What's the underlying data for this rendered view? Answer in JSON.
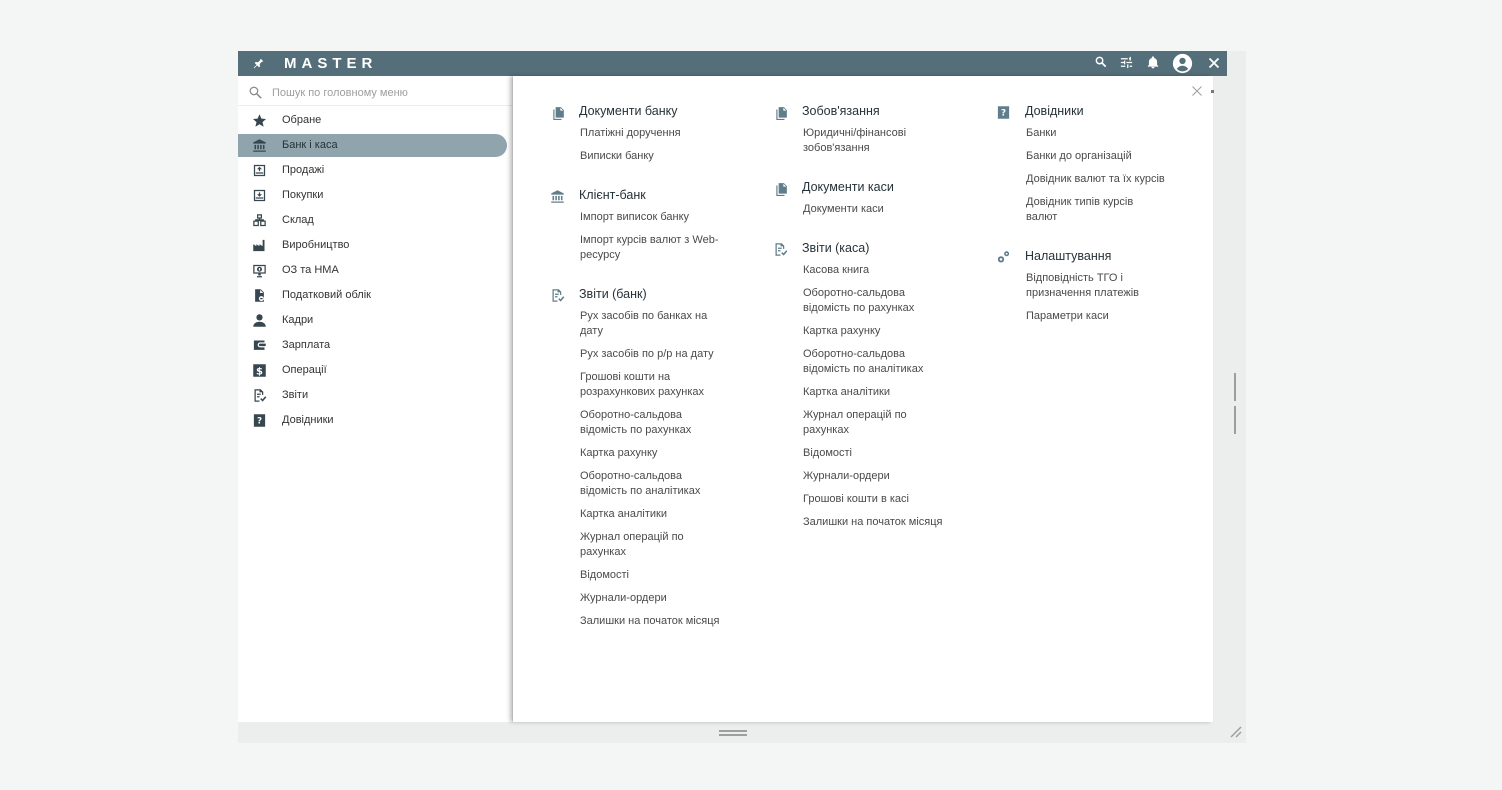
{
  "app": {
    "brand": "MASTER"
  },
  "colors": {
    "topbar": "#546e7a",
    "active_item": "#90a4ae",
    "icon": "#37474f",
    "group_icon": "#607d8b"
  },
  "toolbar": {
    "icons": [
      "pin-icon",
      "search-icon",
      "tune-icon",
      "bell-icon",
      "account-circle-icon",
      "close-icon"
    ]
  },
  "search": {
    "placeholder": "Пошук по головному меню",
    "value": ""
  },
  "sidebar": {
    "active": "Банк і каса",
    "items": [
      {
        "label": "Обране",
        "icon": "star-icon"
      },
      {
        "label": "Банк і каса",
        "icon": "bank-icon"
      },
      {
        "label": "Продажі",
        "icon": "sales-icon"
      },
      {
        "label": "Покупки",
        "icon": "purchases-icon"
      },
      {
        "label": "Склад",
        "icon": "warehouse-icon"
      },
      {
        "label": "Виробництво",
        "icon": "factory-icon"
      },
      {
        "label": "ОЗ та НМА",
        "icon": "assets-icon"
      },
      {
        "label": "Податковий облік",
        "icon": "tax-icon"
      },
      {
        "label": "Кадри",
        "icon": "person-icon"
      },
      {
        "label": "Зарплата",
        "icon": "wallet-icon"
      },
      {
        "label": "Операції",
        "icon": "dollar-icon"
      },
      {
        "label": "Звіти",
        "icon": "report-icon"
      },
      {
        "label": "Довідники",
        "icon": "help-book-icon"
      }
    ]
  },
  "columns": [
    {
      "groups": [
        {
          "title": "Документи банку",
          "icon": "documents-icon",
          "links": [
            "Платіжні доручення",
            "Виписки банку"
          ]
        },
        {
          "title": "Клієнт-банк",
          "icon": "bank-icon",
          "links": [
            "Імпорт виписок банку",
            "Імпорт курсів валют з Web-ресурсу"
          ]
        },
        {
          "title": "Звіти (банк)",
          "icon": "report-icon",
          "links": [
            "Рух засобів по банках на дату",
            "Рух засобів по р/р на дату",
            "Грошові кошти на розрахункових рахунках",
            "Оборотно-сальдова відомість по рахунках",
            "Картка рахунку",
            "Оборотно-сальдова відомість по аналітиках",
            "Картка аналітики",
            "Журнал операцій по рахунках",
            "Відомості",
            "Журнали-ордери",
            "Залишки на початок місяця"
          ]
        }
      ]
    },
    {
      "groups": [
        {
          "title": "Зобов'язання",
          "icon": "documents-icon",
          "links": [
            "Юридичні/фінансові зобов'язання"
          ]
        },
        {
          "title": "Документи каси",
          "icon": "documents-icon",
          "links": [
            "Документи каси"
          ]
        },
        {
          "title": "Звіти (каса)",
          "icon": "report-icon",
          "links": [
            "Касова книга",
            "Оборотно-сальдова відомість по рахунках",
            "Картка рахунку",
            "Оборотно-сальдова відомість по аналітиках",
            "Картка аналітики",
            "Журнал операцій по рахунках",
            "Відомості",
            "Журнали-ордери",
            "Грошові кошти в касі",
            "Залишки на початок місяця"
          ]
        }
      ]
    },
    {
      "groups": [
        {
          "title": "Довідники",
          "icon": "help-book-icon",
          "links": [
            "Банки",
            "Банки до організацій",
            "Довідник валют та їх курсів",
            "Довідник типів курсів валют"
          ]
        },
        {
          "title": "Налаштування",
          "icon": "settings-gears-icon",
          "links": [
            "Відповідність ТГО і призначення платежів",
            "Параметри каси"
          ]
        }
      ]
    }
  ]
}
